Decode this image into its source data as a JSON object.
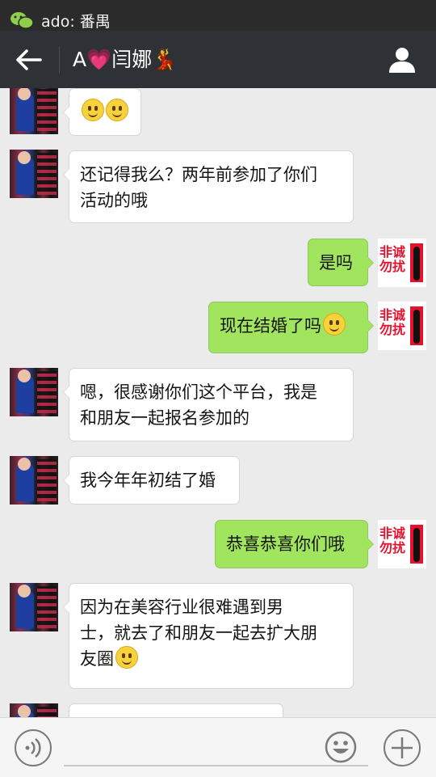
{
  "status_bar": {
    "notification_app_icon": "wechat-icon",
    "notification_text": "ado: 番禺"
  },
  "header": {
    "title": "A💗闫娜💃",
    "back_icon": "back-arrow-icon",
    "profile_icon": "person-icon"
  },
  "messages": [
    {
      "side": "left",
      "text": "",
      "emoji_count": 2
    },
    {
      "side": "left",
      "lines": [
        "还记得我么？两年前参加了你们",
        "活动的哦"
      ]
    },
    {
      "side": "right",
      "text": "是吗"
    },
    {
      "side": "right",
      "text": "现在结婚了吗",
      "emoji_count": 1
    },
    {
      "side": "left",
      "lines": [
        "嗯，很感谢你们这个平台，我是",
        "和朋友一起报名参加的"
      ]
    },
    {
      "side": "left",
      "text": "我今年年初结了婚"
    },
    {
      "side": "right",
      "text": "恭喜恭喜你们哦"
    },
    {
      "side": "left",
      "lines": [
        "因为在美容行业很难遇到男",
        "士，就去了和朋友一起去扩大朋",
        "友圈"
      ],
      "emoji_count": 1
    }
  ],
  "right_avatar_logo": "非诚勿扰",
  "input_bar": {
    "voice_icon": "voice-icon",
    "emoji_icon": "smiley-icon",
    "more_icon": "plus-icon",
    "text_value": ""
  },
  "colors": {
    "title_bar": "#2e3236",
    "chat_background": "#ebebeb",
    "sent_bubble": "#a1e55e",
    "received_bubble": "#ffffff"
  }
}
